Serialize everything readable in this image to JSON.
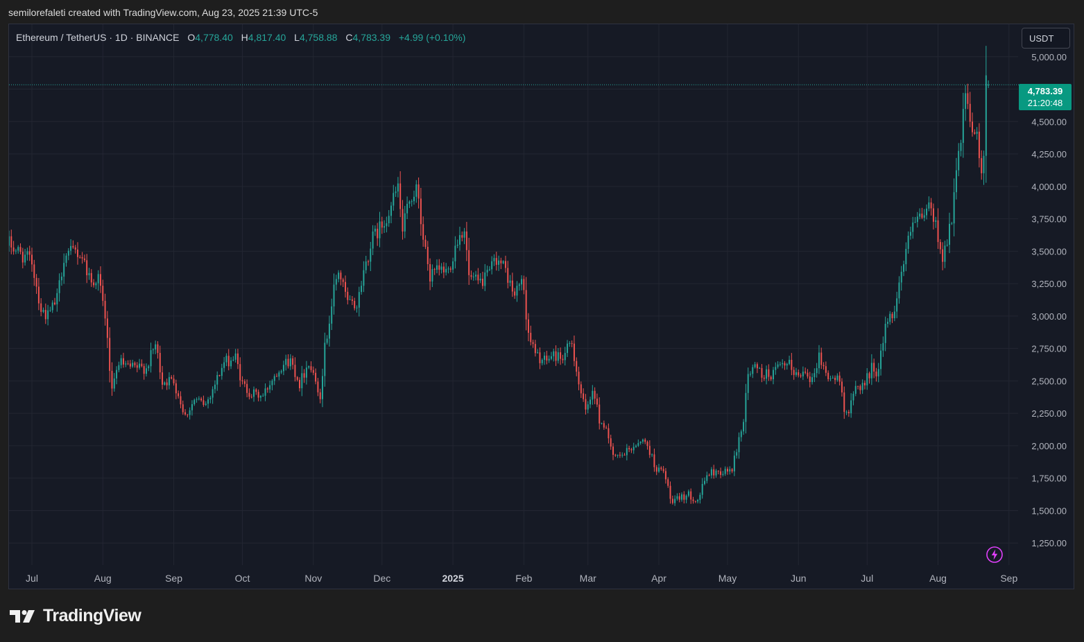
{
  "header": {
    "attribution": "semilorefaleti created with TradingView.com, Aug 23, 2025 21:39 UTC-5"
  },
  "legend": {
    "symbol": "Ethereum / TetherUS · 1D · BINANCE",
    "open_label": "O",
    "open": "4,778.40",
    "high_label": "H",
    "high": "4,817.40",
    "low_label": "L",
    "low": "4,758.88",
    "close_label": "C",
    "close": "4,783.39",
    "change": "+4.99 (+0.10%)"
  },
  "currency_button": "USDT",
  "last_price": {
    "price": "4,783.39",
    "countdown": "21:20:48"
  },
  "icons": {
    "lightning": "lightning-icon",
    "logo": "tradingview-logo-icon"
  },
  "colors": {
    "up": "#26a69a",
    "down": "#ef5350",
    "background": "#161a25",
    "grid": "#232632",
    "axis_text": "#b2b5be",
    "price_tag": "#089981",
    "bolt": "#e040fb"
  },
  "brand": {
    "name": "TradingView"
  },
  "chart_data": {
    "type": "candlestick",
    "title": "Ethereum / TetherUS · 1D · BINANCE",
    "y_axis": {
      "ticks": [
        1250,
        1500,
        1750,
        2000,
        2250,
        2500,
        2750,
        3000,
        3250,
        3500,
        3750,
        4000,
        4250,
        4500,
        5000
      ],
      "tick_labels": [
        "1,250.00",
        "1,500.00",
        "1,750.00",
        "2,000.00",
        "2,250.00",
        "2,500.00",
        "2,750.00",
        "3,000.00",
        "3,250.00",
        "3,500.00",
        "3,750.00",
        "4,000.00",
        "4,250.00",
        "4,500.00",
        "5,000.00"
      ],
      "range": [
        1080,
        5250
      ]
    },
    "x_axis": {
      "start": "2024-06-21",
      "end": "2025-09-05",
      "ticks": [
        {
          "label": "Jul",
          "date": "2024-07-01"
        },
        {
          "label": "Aug",
          "date": "2024-08-01"
        },
        {
          "label": "Sep",
          "date": "2024-09-01"
        },
        {
          "label": "Oct",
          "date": "2024-10-01"
        },
        {
          "label": "Nov",
          "date": "2024-11-01"
        },
        {
          "label": "Dec",
          "date": "2024-12-01"
        },
        {
          "label": "2025",
          "date": "2025-01-01",
          "bold": true
        },
        {
          "label": "Feb",
          "date": "2025-02-01"
        },
        {
          "label": "Mar",
          "date": "2025-03-01"
        },
        {
          "label": "Apr",
          "date": "2025-04-01"
        },
        {
          "label": "May",
          "date": "2025-05-01"
        },
        {
          "label": "Jun",
          "date": "2025-06-01"
        },
        {
          "label": "Jul",
          "date": "2025-07-01"
        },
        {
          "label": "Aug",
          "date": "2025-08-01"
        },
        {
          "label": "Sep",
          "date": "2025-09-01"
        }
      ]
    },
    "last_price": 4783.39,
    "close_path": [
      [
        "2024-06-21",
        3560
      ],
      [
        "2024-06-26",
        3480
      ],
      [
        "2024-07-01",
        3420
      ],
      [
        "2024-07-05",
        3050
      ],
      [
        "2024-07-08",
        3000
      ],
      [
        "2024-07-12",
        3130
      ],
      [
        "2024-07-15",
        3460
      ],
      [
        "2024-07-20",
        3500
      ],
      [
        "2024-07-23",
        3460
      ],
      [
        "2024-07-27",
        3260
      ],
      [
        "2024-07-30",
        3300
      ],
      [
        "2024-08-02",
        3000
      ],
      [
        "2024-08-05",
        2400
      ],
      [
        "2024-08-08",
        2650
      ],
      [
        "2024-08-12",
        2600
      ],
      [
        "2024-08-16",
        2600
      ],
      [
        "2024-08-20",
        2600
      ],
      [
        "2024-08-24",
        2780
      ],
      [
        "2024-08-27",
        2500
      ],
      [
        "2024-09-01",
        2500
      ],
      [
        "2024-09-06",
        2230
      ],
      [
        "2024-09-10",
        2350
      ],
      [
        "2024-09-15",
        2320
      ],
      [
        "2024-09-19",
        2480
      ],
      [
        "2024-09-23",
        2640
      ],
      [
        "2024-09-28",
        2680
      ],
      [
        "2024-10-01",
        2470
      ],
      [
        "2024-10-05",
        2400
      ],
      [
        "2024-10-10",
        2380
      ],
      [
        "2024-10-14",
        2520
      ],
      [
        "2024-10-18",
        2620
      ],
      [
        "2024-10-22",
        2660
      ],
      [
        "2024-10-26",
        2480
      ],
      [
        "2024-10-30",
        2650
      ],
      [
        "2024-11-04",
        2400
      ],
      [
        "2024-11-06",
        2750
      ],
      [
        "2024-11-10",
        3200
      ],
      [
        "2024-11-12",
        3350
      ],
      [
        "2024-11-16",
        3100
      ],
      [
        "2024-11-20",
        3080
      ],
      [
        "2024-11-23",
        3350
      ],
      [
        "2024-11-27",
        3600
      ],
      [
        "2024-12-01",
        3700
      ],
      [
        "2024-12-05",
        3850
      ],
      [
        "2024-12-08",
        4000
      ],
      [
        "2024-12-10",
        3650
      ],
      [
        "2024-12-13",
        3900
      ],
      [
        "2024-12-16",
        3980
      ],
      [
        "2024-12-19",
        3600
      ],
      [
        "2024-12-22",
        3300
      ],
      [
        "2024-12-26",
        3350
      ],
      [
        "2024-12-30",
        3350
      ],
      [
        "2025-01-03",
        3600
      ],
      [
        "2025-01-06",
        3680
      ],
      [
        "2025-01-08",
        3300
      ],
      [
        "2025-01-12",
        3250
      ],
      [
        "2025-01-16",
        3300
      ],
      [
        "2025-01-20",
        3450
      ],
      [
        "2025-01-24",
        3350
      ],
      [
        "2025-01-28",
        3150
      ],
      [
        "2025-01-31",
        3300
      ],
      [
        "2025-02-03",
        2880
      ],
      [
        "2025-02-06",
        2700
      ],
      [
        "2025-02-10",
        2650
      ],
      [
        "2025-02-14",
        2700
      ],
      [
        "2025-02-18",
        2680
      ],
      [
        "2025-02-22",
        2800
      ],
      [
        "2025-02-25",
        2480
      ],
      [
        "2025-02-28",
        2250
      ],
      [
        "2025-03-03",
        2450
      ],
      [
        "2025-03-06",
        2200
      ],
      [
        "2025-03-09",
        2150
      ],
      [
        "2025-03-12",
        1900
      ],
      [
        "2025-03-16",
        1920
      ],
      [
        "2025-03-20",
        1980
      ],
      [
        "2025-03-24",
        2050
      ],
      [
        "2025-03-27",
        2000
      ],
      [
        "2025-03-31",
        1820
      ],
      [
        "2025-04-03",
        1800
      ],
      [
        "2025-04-07",
        1550
      ],
      [
        "2025-04-10",
        1600
      ],
      [
        "2025-04-14",
        1620
      ],
      [
        "2025-04-18",
        1580
      ],
      [
        "2025-04-22",
        1780
      ],
      [
        "2025-04-26",
        1800
      ],
      [
        "2025-04-30",
        1800
      ],
      [
        "2025-05-03",
        1820
      ],
      [
        "2025-05-08",
        2200
      ],
      [
        "2025-05-10",
        2550
      ],
      [
        "2025-05-13",
        2600
      ],
      [
        "2025-05-16",
        2550
      ],
      [
        "2025-05-20",
        2550
      ],
      [
        "2025-05-24",
        2600
      ],
      [
        "2025-05-28",
        2620
      ],
      [
        "2025-06-01",
        2530
      ],
      [
        "2025-06-04",
        2600
      ],
      [
        "2025-06-07",
        2500
      ],
      [
        "2025-06-10",
        2700
      ],
      [
        "2025-06-13",
        2550
      ],
      [
        "2025-06-16",
        2520
      ],
      [
        "2025-06-19",
        2500
      ],
      [
        "2025-06-21",
        2300
      ],
      [
        "2025-06-23",
        2250
      ],
      [
        "2025-06-26",
        2450
      ],
      [
        "2025-06-30",
        2480
      ],
      [
        "2025-07-03",
        2600
      ],
      [
        "2025-07-06",
        2570
      ],
      [
        "2025-07-09",
        2950
      ],
      [
        "2025-07-12",
        3000
      ],
      [
        "2025-07-15",
        3250
      ],
      [
        "2025-07-18",
        3500
      ],
      [
        "2025-07-21",
        3700
      ],
      [
        "2025-07-25",
        3750
      ],
      [
        "2025-07-28",
        3850
      ],
      [
        "2025-07-31",
        3700
      ],
      [
        "2025-08-03",
        3450
      ],
      [
        "2025-08-05",
        3600
      ],
      [
        "2025-08-07",
        3750
      ],
      [
        "2025-08-09",
        4100
      ],
      [
        "2025-08-11",
        4350
      ],
      [
        "2025-08-13",
        4700
      ],
      [
        "2025-08-15",
        4450
      ],
      [
        "2025-08-17",
        4450
      ],
      [
        "2025-08-19",
        4250
      ],
      [
        "2025-08-20",
        4100
      ],
      [
        "2025-08-21",
        4250
      ],
      [
        "2025-08-22",
        4780
      ],
      [
        "2025-08-23",
        4783.39
      ]
    ]
  }
}
